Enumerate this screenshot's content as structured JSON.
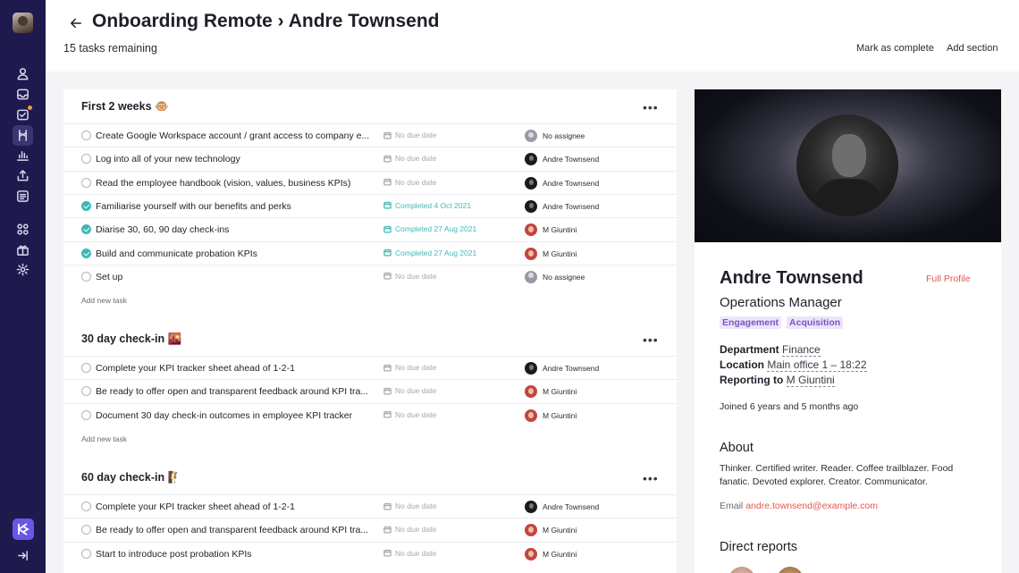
{
  "header": {
    "title": "Onboarding Remote › Andre Townsend",
    "subtitle": "15 tasks remaining",
    "mark_complete": "Mark as complete",
    "add_section": "Add section"
  },
  "sections": [
    {
      "title": "First 2 weeks 🐵",
      "add_task": "Add new task",
      "tasks": [
        {
          "name": "Create Google Workspace account / grant access to company e...",
          "done": false,
          "due": "No due date",
          "assignee": "No assignee",
          "avatar": "none"
        },
        {
          "name": "Log into all of your new technology",
          "done": false,
          "due": "No due date",
          "assignee": "Andre Townsend",
          "avatar": "andre"
        },
        {
          "name": "Read the employee handbook (vision, values, business KPIs)",
          "done": false,
          "due": "No due date",
          "assignee": "Andre Townsend",
          "avatar": "andre"
        },
        {
          "name": "Familiarise yourself with our benefits and perks",
          "done": true,
          "due": "Completed 4 Oct 2021",
          "assignee": "Andre Townsend",
          "avatar": "andre"
        },
        {
          "name": "Diarise 30, 60, 90 day check-ins",
          "done": true,
          "due": "Completed 27 Aug 2021",
          "assignee": "M Giuntini",
          "avatar": "giuntini"
        },
        {
          "name": "Build and communicate probation KPIs",
          "done": true,
          "due": "Completed 27 Aug 2021",
          "assignee": "M Giuntini",
          "avatar": "giuntini"
        },
        {
          "name": "Set up",
          "done": false,
          "due": "No due date",
          "assignee": "No assignee",
          "avatar": "none"
        }
      ]
    },
    {
      "title": "30 day check-in 🌇",
      "add_task": "Add new task",
      "tasks": [
        {
          "name": "Complete your KPI tracker sheet ahead of 1-2-1",
          "done": false,
          "due": "No due date",
          "assignee": "Andre Townsend",
          "avatar": "andre"
        },
        {
          "name": "Be ready to offer open and transparent feedback around KPI tra...",
          "done": false,
          "due": "No due date",
          "assignee": "M Giuntini",
          "avatar": "giuntini"
        },
        {
          "name": "Document 30 day check-in outcomes in employee KPI tracker",
          "done": false,
          "due": "No due date",
          "assignee": "M Giuntini",
          "avatar": "giuntini"
        }
      ]
    },
    {
      "title": "60 day check-in 🧗",
      "add_task": "",
      "tasks": [
        {
          "name": "Complete your KPI tracker sheet ahead of 1-2-1",
          "done": false,
          "due": "No due date",
          "assignee": "Andre Townsend",
          "avatar": "andre"
        },
        {
          "name": "Be ready to offer open and transparent feedback around KPI tra...",
          "done": false,
          "due": "No due date",
          "assignee": "M Giuntini",
          "avatar": "giuntini"
        },
        {
          "name": "Start to introduce post probation KPIs",
          "done": false,
          "due": "No due date",
          "assignee": "M Giuntini",
          "avatar": "giuntini"
        }
      ]
    }
  ],
  "profile": {
    "name": "Andre Townsend",
    "full_profile": "Full Profile",
    "role": "Operations Manager",
    "tags": [
      "Engagement",
      "Acquisition"
    ],
    "department_label": "Department",
    "department": "Finance",
    "location_label": "Location",
    "location": "Main office 1 – 18:22",
    "reporting_label": "Reporting to",
    "reporting_to": "M Giuntini",
    "joined": "Joined 6 years and 5 months ago",
    "about_heading": "About",
    "about": "Thinker. Certified writer. Reader. Coffee trailblazer. Food fanatic. Devoted explorer. Creator. Communicator.",
    "email_label": "Email",
    "email": "andre.townsend@example.com",
    "direct_reports_heading": "Direct reports"
  },
  "colors": {
    "sidebar": "#1e1a4d",
    "accent_complete": "#3cb9b5",
    "link_red": "#e5574f",
    "tag_purple": "#7a55c6"
  }
}
